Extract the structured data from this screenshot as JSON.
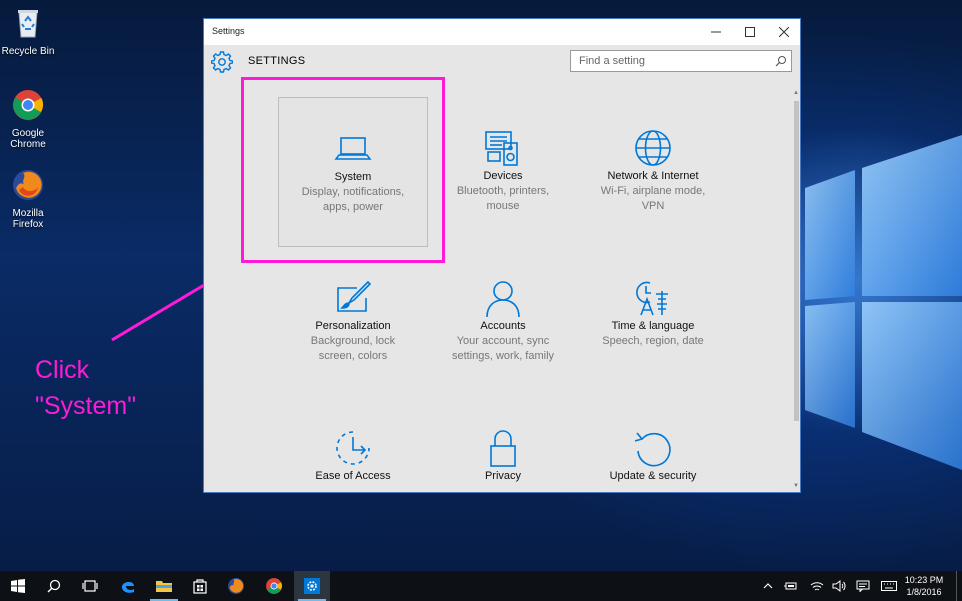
{
  "desktop": {
    "icons": [
      {
        "label": "Recycle Bin"
      },
      {
        "label": "Google\nChrome"
      },
      {
        "label": "Mozilla\nFirefox"
      }
    ],
    "annotation": "Click\n\"System\"",
    "annotation_color": "#ff1ad9"
  },
  "window": {
    "title": "Settings",
    "heading": "SETTINGS",
    "search_placeholder": "Find a setting",
    "accent": "#0078d7",
    "tiles": [
      {
        "title": "System",
        "desc": "Display, notifications,\napps, power",
        "icon": "laptop-icon"
      },
      {
        "title": "Devices",
        "desc": "Bluetooth, printers,\nmouse",
        "icon": "devices-icon"
      },
      {
        "title": "Network & Internet",
        "desc": "Wi-Fi, airplane mode,\nVPN",
        "icon": "globe-icon"
      },
      {
        "title": "Personalization",
        "desc": "Background, lock\nscreen, colors",
        "icon": "paintbrush-icon"
      },
      {
        "title": "Accounts",
        "desc": "Your account, sync\nsettings, work, family",
        "icon": "person-icon"
      },
      {
        "title": "Time & language",
        "desc": "Speech, region, date",
        "icon": "time-language-icon"
      },
      {
        "title": "Ease of Access",
        "desc": "",
        "icon": "ease-of-access-icon"
      },
      {
        "title": "Privacy",
        "desc": "",
        "icon": "lock-icon"
      },
      {
        "title": "Update & security",
        "desc": "",
        "icon": "update-icon"
      }
    ]
  },
  "taskbar": {
    "time": "10:23 PM",
    "date": "1/8/2016"
  }
}
